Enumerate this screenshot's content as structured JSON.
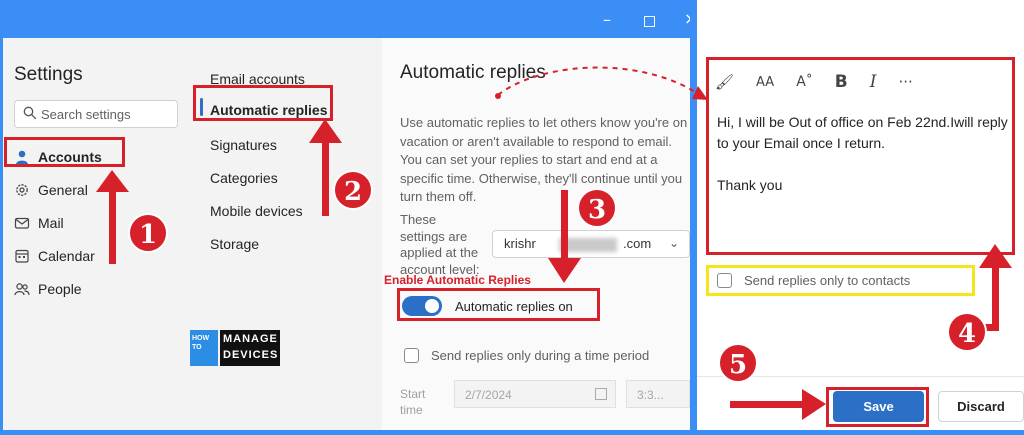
{
  "settings": {
    "title": "Settings",
    "search_placeholder": "Search settings",
    "nav": [
      {
        "label": "Accounts",
        "icon": "person-icon"
      },
      {
        "label": "General",
        "icon": "gear-icon"
      },
      {
        "label": "Mail",
        "icon": "mail-icon"
      },
      {
        "label": "Calendar",
        "icon": "calendar-icon"
      },
      {
        "label": "People",
        "icon": "people-icon"
      }
    ]
  },
  "accounts_menu": {
    "items": [
      "Email accounts",
      "Automatic replies",
      "Signatures",
      "Categories",
      "Mobile devices",
      "Storage"
    ]
  },
  "automatic_replies": {
    "title": "Automatic replies",
    "description": "Use automatic replies to let others know you're on vacation or aren't available to respond to email. You can set your replies to start and end at a specific time. Otherwise, they'll continue until you turn them off.",
    "applied_label": "These settings are applied at the account level:",
    "account_value_start": "krishr",
    "account_value_end": ".com",
    "toggle_label": "Automatic replies on",
    "time_period_label": "Send replies only during a time period",
    "start_label": "Start time",
    "start_date": "2/7/2024",
    "start_time": "3:3..."
  },
  "editor": {
    "message_lines": [
      "Hi, I will be Out of office on Feb 22nd.Iwill reply to your Email once I return.",
      "",
      "Thank you"
    ],
    "contacts_label": "Send replies only to contacts",
    "save_label": "Save",
    "discard_label": "Discard"
  },
  "annotations": {
    "enable_label": "Enable Automatic Replies",
    "steps": [
      "1",
      "2",
      "3",
      "4",
      "5"
    ],
    "logo_top": "HOW TO",
    "logo_manage": "MANAGE",
    "logo_devices": "DEVICES"
  },
  "colors": {
    "accent": "#2b6fc7",
    "annotation_red": "#d6202a",
    "highlight_yellow": "#f5e51a",
    "frame_blue": "#3a8ef6"
  }
}
